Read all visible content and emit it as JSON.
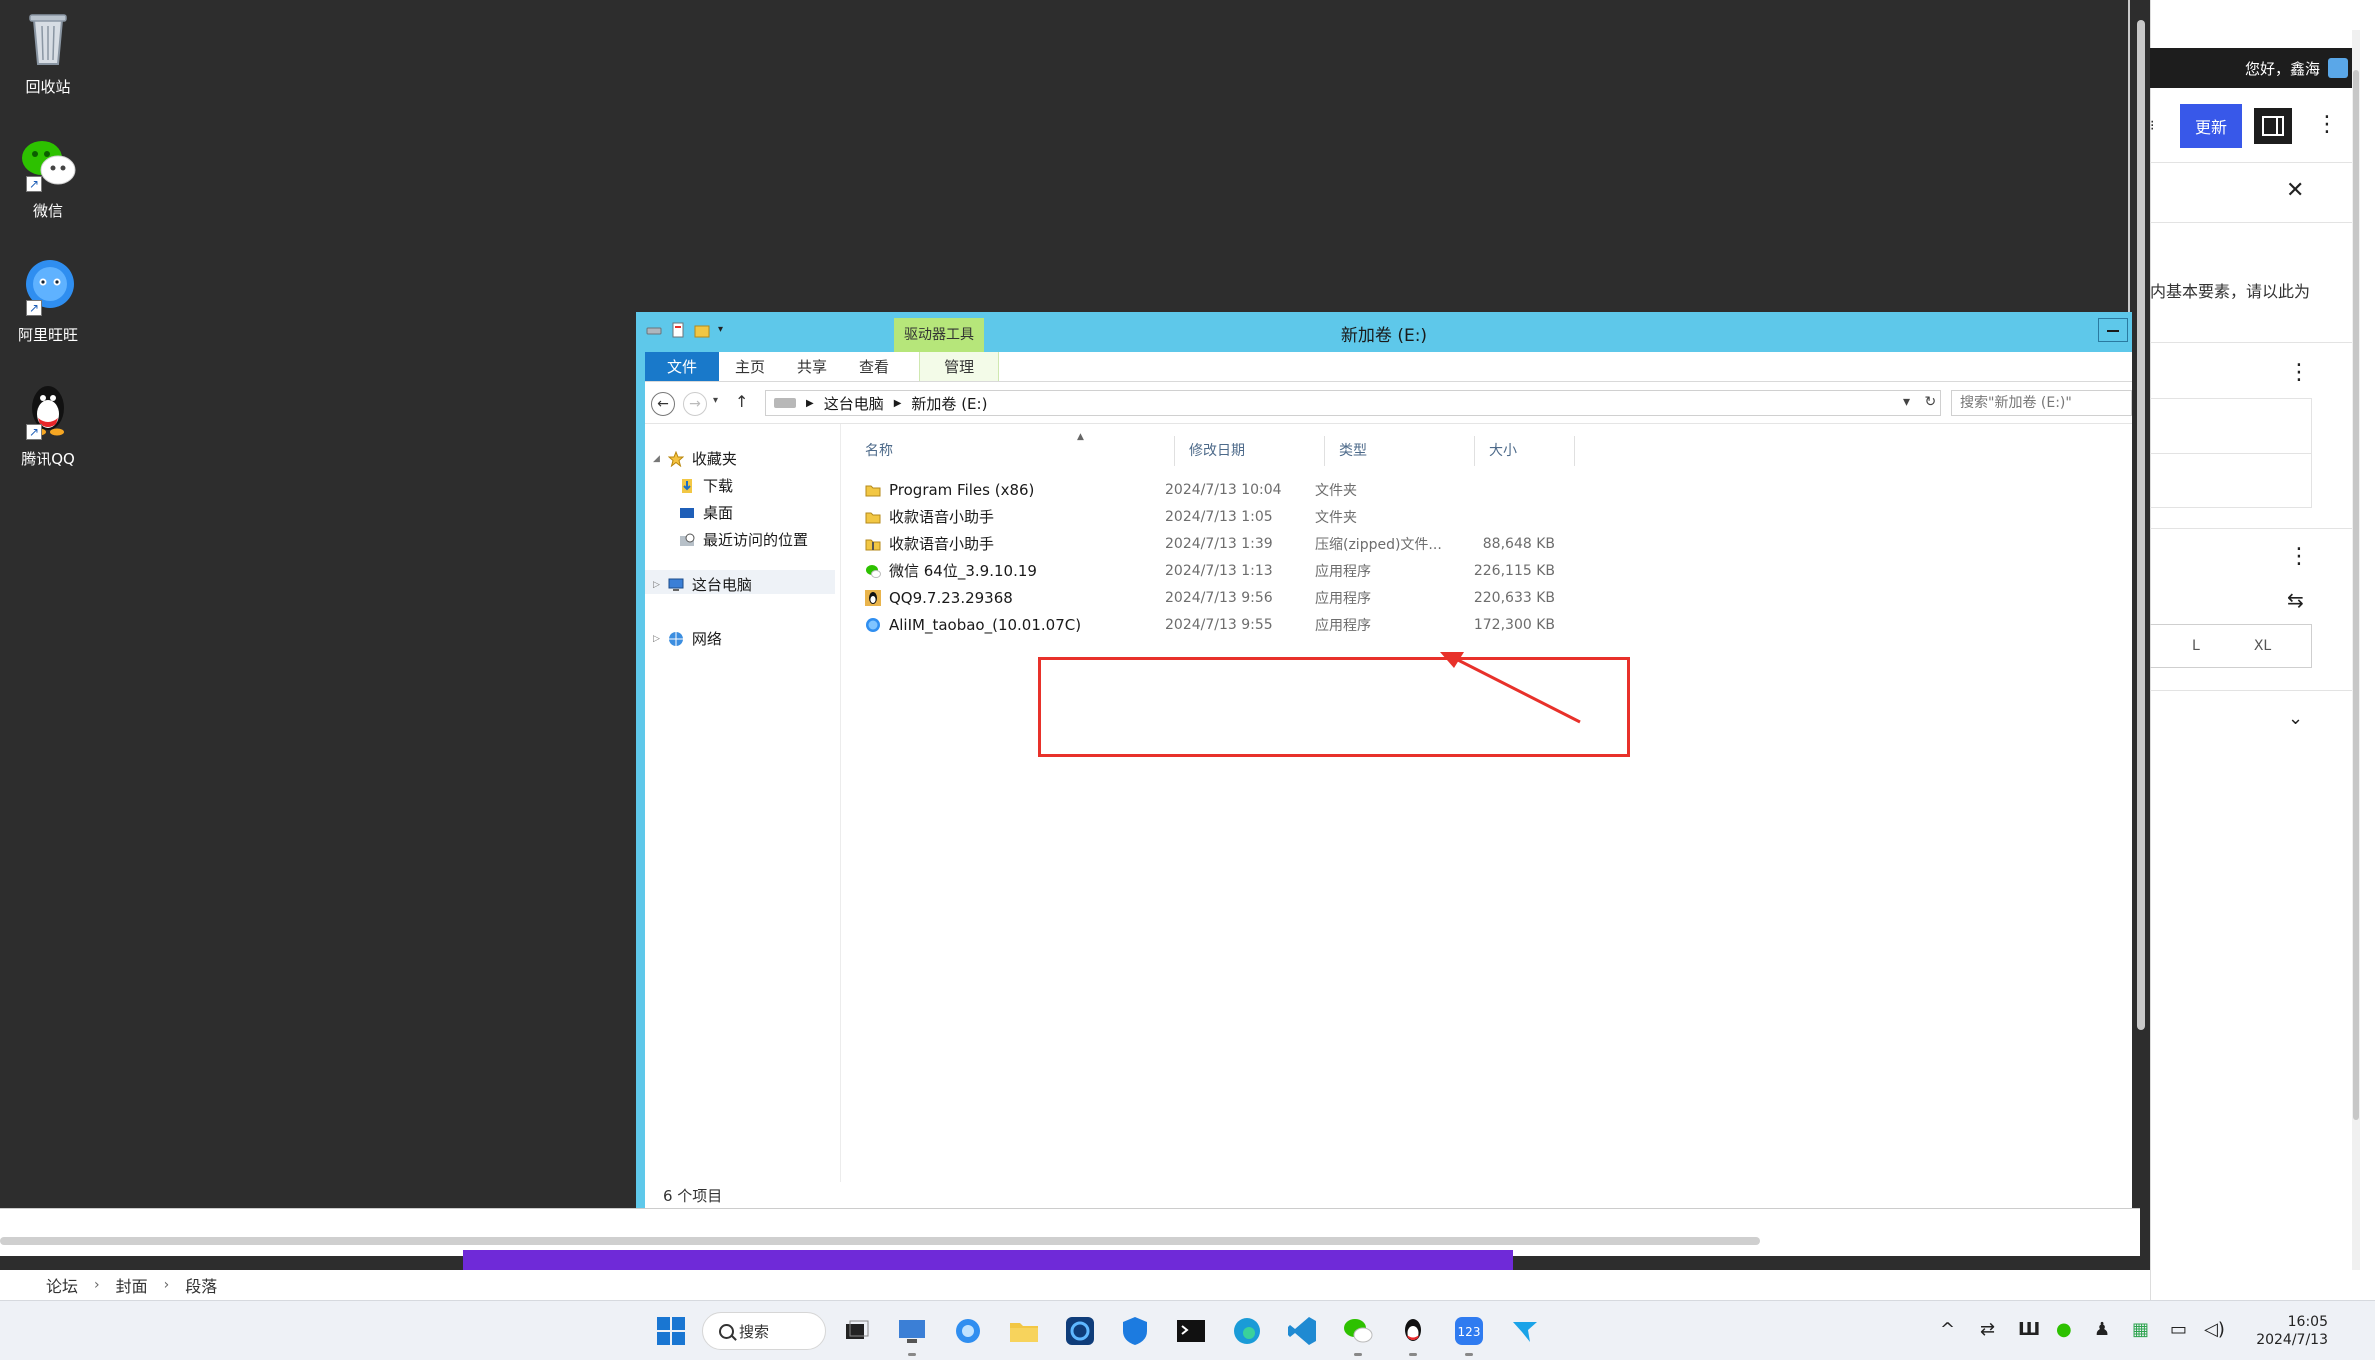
{
  "desktop": {
    "icons": [
      {
        "label": "回收站",
        "icon": "recycle-bin-icon"
      },
      {
        "label": "微信",
        "icon": "wechat-icon"
      },
      {
        "label": "阿里旺旺",
        "icon": "aliwangwang-icon"
      },
      {
        "label": "腾讯QQ",
        "icon": "qq-icon"
      }
    ]
  },
  "explorer": {
    "title": "新加卷 (E:)",
    "context_tab": "驱动器工具",
    "ribbon": {
      "tabs": [
        "文件",
        "主页",
        "共享",
        "查看"
      ],
      "context_subtab": "管理"
    },
    "address": {
      "path": [
        "这台电脑",
        "新加卷 (E:)"
      ],
      "search_placeholder": "搜索\"新加卷 (E:)\""
    },
    "nav": {
      "favorites": "收藏夹",
      "downloads": "下载",
      "desktop": "桌面",
      "recent": "最近访问的位置",
      "this_pc": "这台电脑",
      "network": "网络"
    },
    "columns": [
      "名称",
      "修改日期",
      "类型",
      "大小"
    ],
    "files": [
      {
        "name": "Program Files (x86)",
        "date": "2024/7/13 10:04",
        "type": "文件夹",
        "size": "",
        "icon": "folder-icon"
      },
      {
        "name": "收款语音小助手",
        "date": "2024/7/13 1:05",
        "type": "文件夹",
        "size": "",
        "icon": "folder-icon"
      },
      {
        "name": "收款语音小助手",
        "date": "2024/7/13 1:39",
        "type": "压缩(zipped)文件...",
        "size": "88,648 KB",
        "icon": "zip-folder-icon"
      },
      {
        "name": "微信 64位_3.9.10.19",
        "date": "2024/7/13 1:13",
        "type": "应用程序",
        "size": "226,115 KB",
        "icon": "wechat-installer-icon"
      },
      {
        "name": "QQ9.7.23.29368",
        "date": "2024/7/13 9:56",
        "type": "应用程序",
        "size": "220,633 KB",
        "icon": "qq-installer-icon"
      },
      {
        "name": "AliIM_taobao_(10.01.07C)",
        "date": "2024/7/13 9:55",
        "type": "应用程序",
        "size": "172,300 KB",
        "icon": "aliim-installer-icon"
      }
    ],
    "status": "6 个项目"
  },
  "bottom_breadcrumb": [
    "论坛",
    "封面",
    "段落"
  ],
  "right_panel": {
    "greeting": "您好，鑫海",
    "update_button": "更新",
    "text_snippet": "内基本要素，请以此为",
    "sizes": [
      "L",
      "XL"
    ]
  },
  "taskbar": {
    "search_label": "搜索",
    "time": "16:05",
    "date": "2024/7/13"
  },
  "colors": {
    "explorer_chrome": "#5ec8ea",
    "file_tab": "#1979ca",
    "context_tab": "#b6e67a",
    "highlight": "#e8312a",
    "update_button": "#3858e9"
  }
}
